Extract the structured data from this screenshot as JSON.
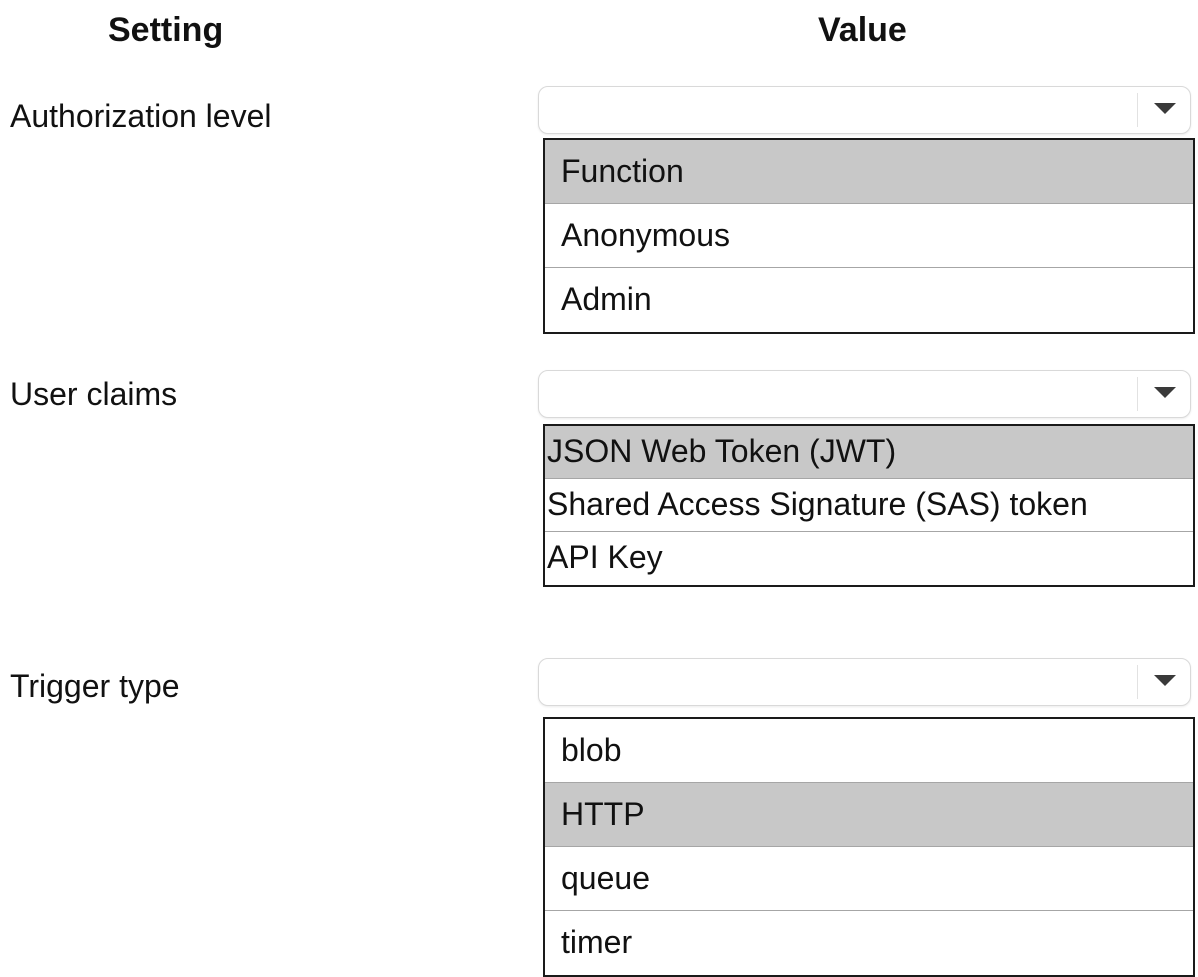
{
  "headers": {
    "setting": "Setting",
    "value": "Value"
  },
  "rows": [
    {
      "label": "Authorization level",
      "options": [
        "Function",
        "Anonymous",
        "Admin"
      ],
      "selected_option": "Function"
    },
    {
      "label": "User claims",
      "options": [
        "JSON Web Token (JWT)",
        "Shared Access Signature (SAS) token",
        "API Key"
      ],
      "selected_option": "JSON Web Token (JWT)"
    },
    {
      "label": "Trigger type",
      "options": [
        "blob",
        "HTTP",
        "queue",
        "timer"
      ],
      "selected_option": "HTTP"
    }
  ],
  "icons": {
    "dropdown_arrow": "chevron-down-icon"
  },
  "colors": {
    "selected_option_bg": "#c8c8c8",
    "list_border": "#1a1a1a"
  }
}
